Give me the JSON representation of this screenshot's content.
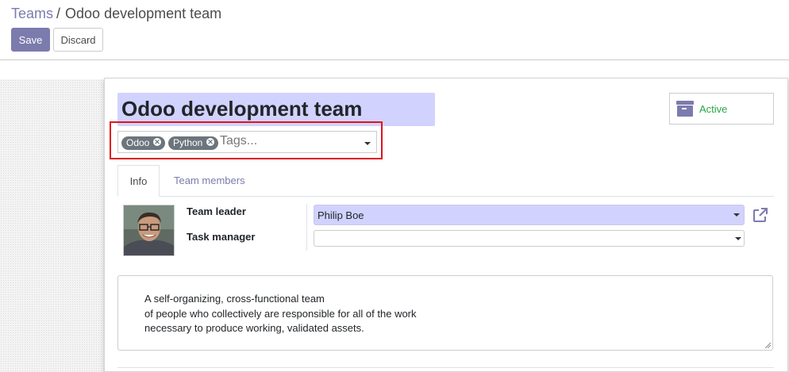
{
  "breadcrumb": {
    "parent": "Teams",
    "separator": "/",
    "current": "Odoo development team"
  },
  "toolbar": {
    "save_label": "Save",
    "discard_label": "Discard"
  },
  "form": {
    "name": "Odoo development team",
    "active_label": "Active",
    "tags": [
      {
        "label": "Odoo"
      },
      {
        "label": "Python"
      }
    ],
    "tags_placeholder": "Tags...",
    "tabs": [
      {
        "label": "Info"
      },
      {
        "label": "Team members"
      }
    ],
    "team_leader_label": "Team leader",
    "team_leader_value": "Philip Boe",
    "task_manager_label": "Task manager",
    "task_manager_value": "",
    "description_lines": [
      "A self-organizing, cross-functional team",
      "of people who collectively are responsible for all of the work",
      "necessary to produce working, validated assets."
    ]
  },
  "colors": {
    "brand": "#7c7bad",
    "required_field_bg": "#d2d2ff",
    "active_green": "#28a745",
    "tag_bg": "#6c757d",
    "highlight_red": "#e0141e"
  },
  "icons": {
    "active": "archive-icon",
    "tag_remove": "times-icon",
    "dropdown": "caret-down-icon",
    "external": "external-link-icon"
  }
}
